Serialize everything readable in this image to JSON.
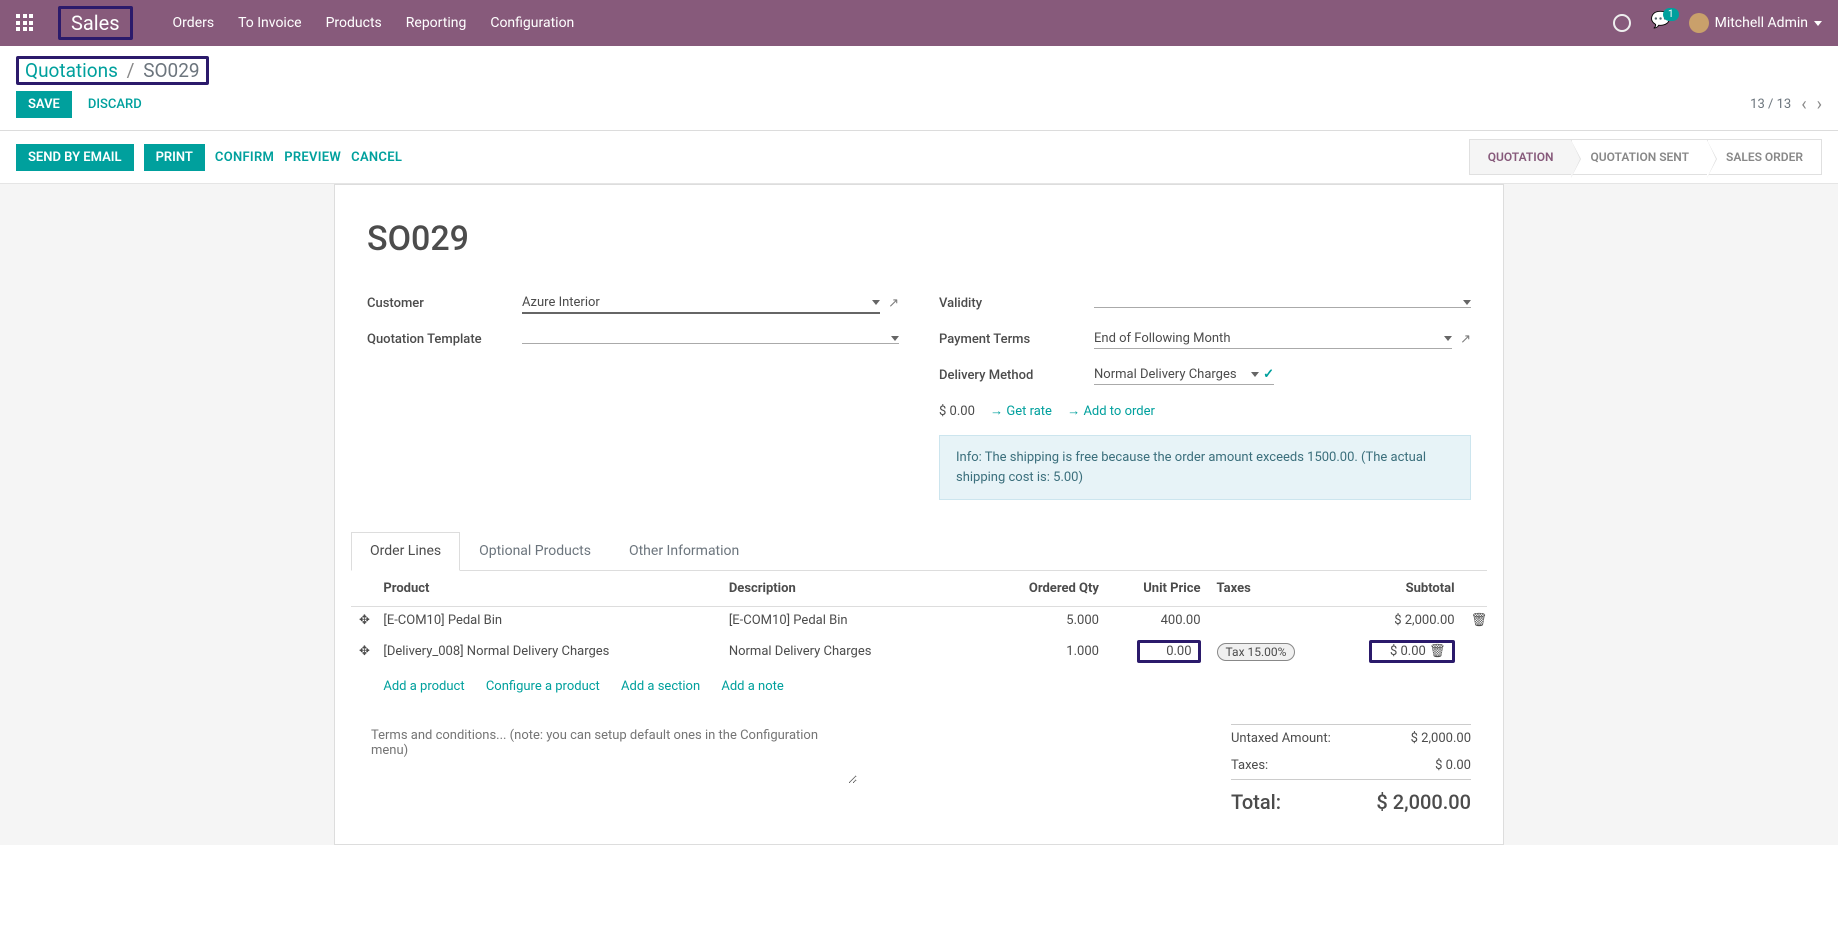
{
  "topbar": {
    "brand": "Sales",
    "menu": [
      "Orders",
      "To Invoice",
      "Products",
      "Reporting",
      "Configuration"
    ],
    "chat_count": "1",
    "user": "Mitchell Admin"
  },
  "breadcrumb": {
    "root": "Quotations",
    "current": "SO029"
  },
  "pager": {
    "pos": "13 / 13"
  },
  "edit": {
    "save": "SAVE",
    "discard": "DISCARD"
  },
  "actions": {
    "send_email": "SEND BY EMAIL",
    "print": "PRINT",
    "confirm": "CONFIRM",
    "preview": "PREVIEW",
    "cancel": "CANCEL"
  },
  "status": {
    "quotation": "QUOTATION",
    "sent": "QUOTATION SENT",
    "order": "SALES ORDER"
  },
  "record": {
    "name": "SO029"
  },
  "fields": {
    "customer_label": "Customer",
    "customer": "Azure Interior",
    "template_label": "Quotation Template",
    "template": "",
    "validity_label": "Validity",
    "validity": "",
    "terms_label": "Payment Terms",
    "terms": "End of Following Month",
    "delivery_label": "Delivery Method",
    "delivery": "Normal Delivery Charges",
    "rate_amount": "$ 0.00",
    "get_rate": "Get rate",
    "add_order": "Add to order",
    "info": "Info: The shipping is free because the order amount exceeds 1500.00. (The actual shipping cost is: 5.00)"
  },
  "tabs": {
    "lines": "Order Lines",
    "optional": "Optional Products",
    "other": "Other Information"
  },
  "table": {
    "headers": {
      "product": "Product",
      "desc": "Description",
      "qty": "Ordered Qty",
      "price": "Unit Price",
      "taxes": "Taxes",
      "subtotal": "Subtotal"
    },
    "rows": [
      {
        "product": "[E-COM10] Pedal Bin",
        "desc": "[E-COM10] Pedal Bin",
        "qty": "5.000",
        "price": "400.00",
        "tax": "",
        "subtotal": "$ 2,000.00",
        "hl": false
      },
      {
        "product": "[Delivery_008] Normal Delivery Charges",
        "desc": "Normal Delivery Charges",
        "qty": "1.000",
        "price": "0.00",
        "tax": "Tax 15.00%",
        "subtotal": "$ 0.00",
        "hl": true
      }
    ],
    "add": {
      "product": "Add a product",
      "configure": "Configure a product",
      "section": "Add a section",
      "note": "Add a note"
    }
  },
  "terms_placeholder": "Terms and conditions... (note: you can setup default ones in the Configuration menu)",
  "totals": {
    "untaxed_label": "Untaxed Amount:",
    "untaxed": "$ 2,000.00",
    "taxes_label": "Taxes:",
    "taxes": "$ 0.00",
    "total_label": "Total:",
    "total": "$ 2,000.00"
  }
}
